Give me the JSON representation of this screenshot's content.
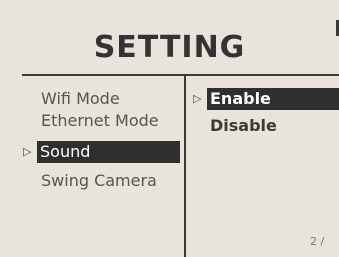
{
  "header": {
    "title": "SETTING"
  },
  "left_menu": {
    "cursor": "▷",
    "items": [
      {
        "label": "Wifi Mode"
      },
      {
        "label": "Ethernet Mode"
      },
      {
        "label": "Sound"
      },
      {
        "label": "Swing Camera"
      }
    ],
    "selected_label": "Sound"
  },
  "right_menu": {
    "cursor": "▷",
    "items": [
      {
        "label": "Enable"
      },
      {
        "label": "Disable"
      }
    ],
    "selected_label": "Enable"
  },
  "footer": {
    "page_indicator": "2 /"
  },
  "colors": {
    "background": "#e8e4db",
    "text": "#555555",
    "highlight_bg": "#2f2f2f",
    "highlight_text": "#ffffff",
    "rule": "#3a3a3a"
  }
}
